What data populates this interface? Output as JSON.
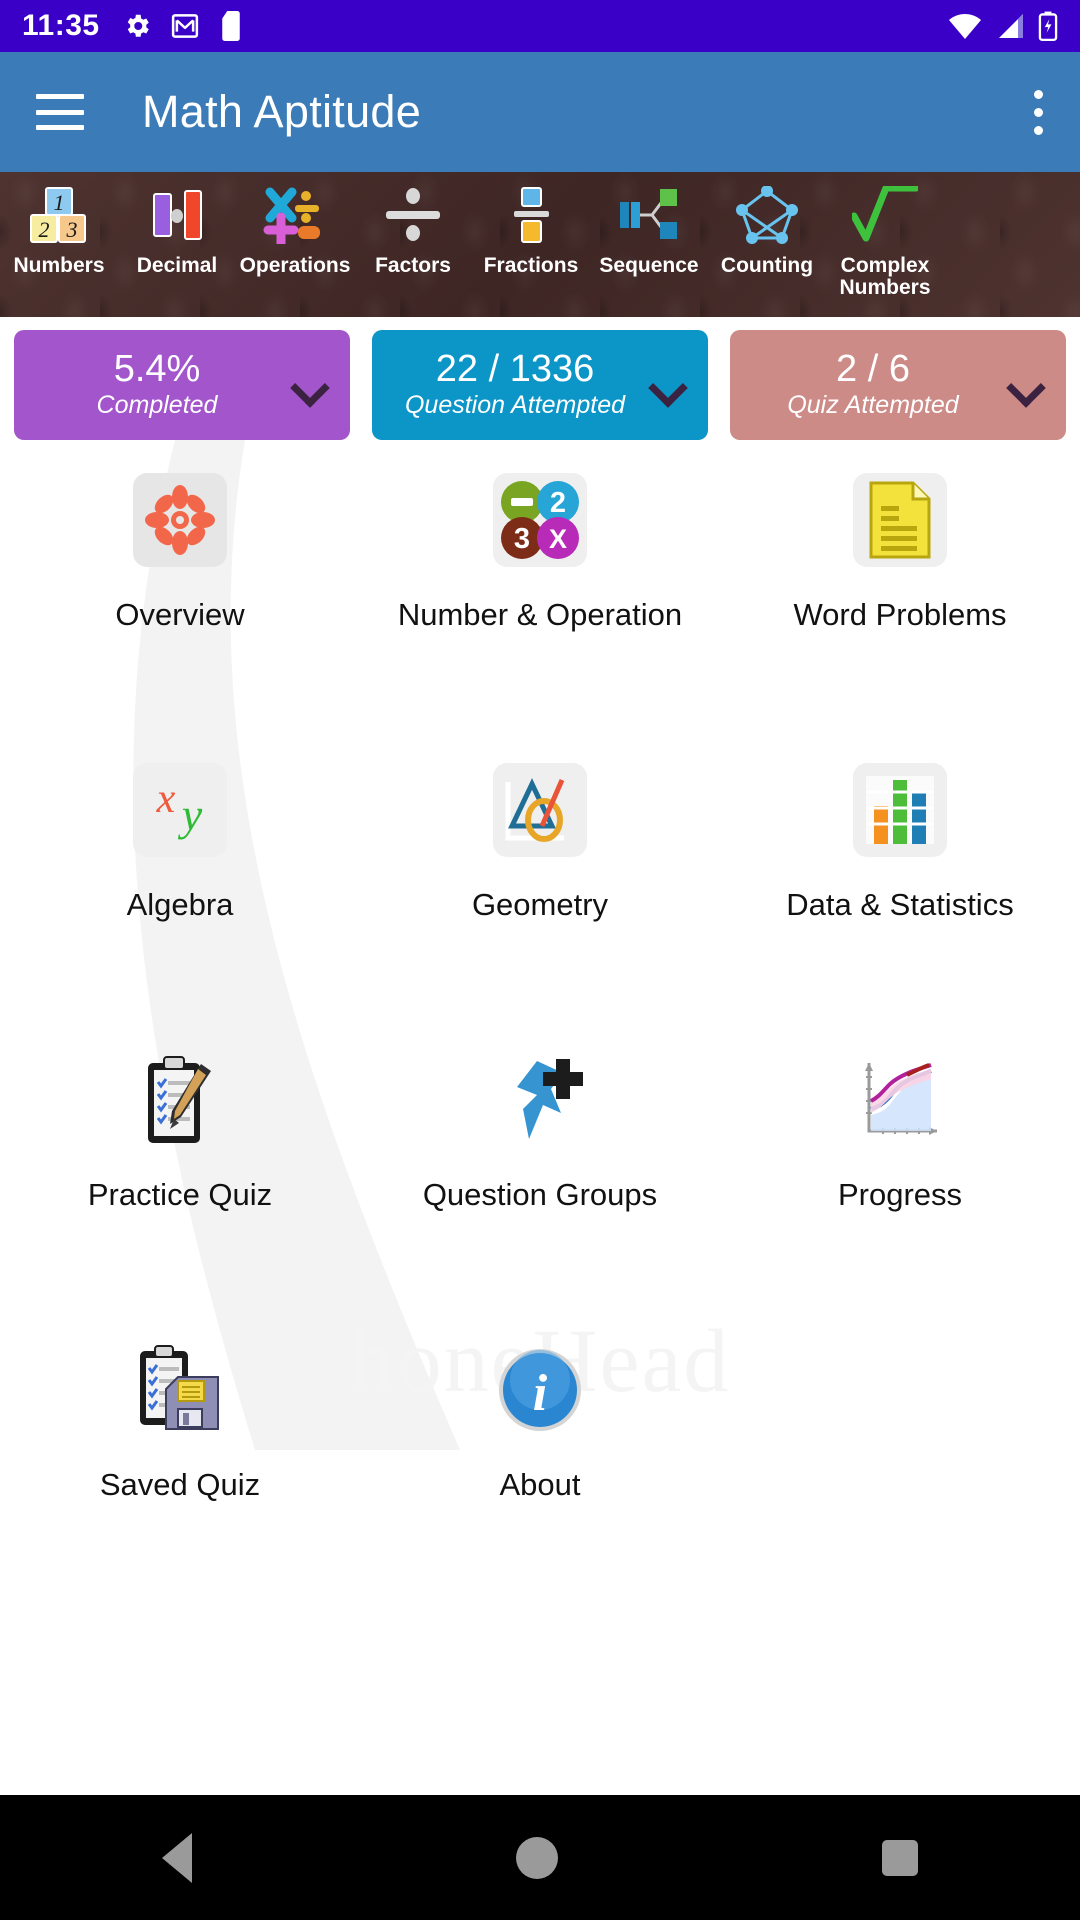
{
  "status_bar": {
    "time": "11:35",
    "left_icons": [
      "settings-gear-icon",
      "gmail-icon",
      "sd-card-icon"
    ],
    "right_icons": [
      "wifi-icon",
      "cellular-signal-icon",
      "battery-charging-icon"
    ],
    "background_color": "#3a00c8"
  },
  "app_bar": {
    "title": "Math Aptitude",
    "menu_icon": "hamburger-menu-icon",
    "overflow_icon": "overflow-menu-icon",
    "background_color": "#3b7cb8"
  },
  "category_strip": {
    "background_color": "#4a2f2c",
    "items": [
      {
        "label": "Numbers",
        "icon": "number-blocks-icon"
      },
      {
        "label": "Decimal",
        "icon": "decimal-bars-icon"
      },
      {
        "label": "Operations",
        "icon": "operations-symbols-icon"
      },
      {
        "label": "Factors",
        "icon": "division-sign-icon"
      },
      {
        "label": "Fractions",
        "icon": "fraction-bars-icon"
      },
      {
        "label": "Sequence",
        "icon": "sequence-nodes-icon"
      },
      {
        "label": "Counting",
        "icon": "counting-graph-icon"
      },
      {
        "label": "Complex Numbers",
        "icon": "radical-sign-icon"
      }
    ]
  },
  "stat_cards": [
    {
      "value": "5.4%",
      "label": "Completed",
      "color": "#a355cc",
      "chevron": "chevron-down-icon"
    },
    {
      "value": "22 / 1336",
      "label": "Question Attempted",
      "color": "#0c95c7",
      "chevron": "chevron-down-icon"
    },
    {
      "value": "2 / 6",
      "label": "Quiz Attempted",
      "color": "#cc8b87",
      "chevron": "chevron-down-icon"
    }
  ],
  "watermark": "honeHead",
  "grid": {
    "tiles": [
      {
        "label": "Overview",
        "icon": "overview-flower-icon"
      },
      {
        "label": "Number & Operation",
        "icon": "number-operation-circles-icon"
      },
      {
        "label": "Word Problems",
        "icon": "word-problems-document-icon"
      },
      {
        "label": "Algebra",
        "icon": "algebra-xy-icon"
      },
      {
        "label": "Geometry",
        "icon": "geometry-shapes-icon"
      },
      {
        "label": "Data & Statistics",
        "icon": "bar-chart-icon"
      },
      {
        "label": "Practice Quiz",
        "icon": "clipboard-pencil-icon"
      },
      {
        "label": "Question Groups",
        "icon": "blue-pin-plus-icon"
      },
      {
        "label": "Progress",
        "icon": "progress-line-chart-icon"
      },
      {
        "label": "Saved Quiz",
        "icon": "clipboard-floppy-icon"
      },
      {
        "label": "About",
        "icon": "info-circle-icon"
      }
    ]
  },
  "nav_bar": {
    "back": "back-triangle-icon",
    "home": "home-circle-icon",
    "recents": "recents-square-icon"
  }
}
